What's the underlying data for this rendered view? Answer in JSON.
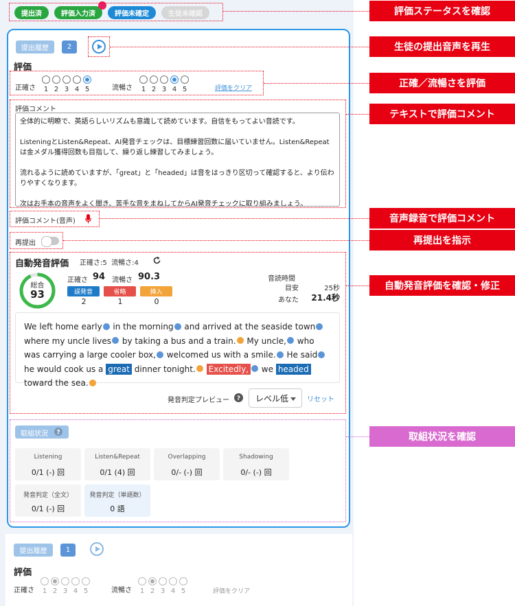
{
  "status_pills": [
    "提出済",
    "評価入力済",
    "評価未確定",
    "生徒未確認"
  ],
  "callouts": {
    "status": "評価ステータスを確認",
    "play": "生徒の提出音声を再生",
    "rate": "正確／流暢さを評価",
    "text_comment": "テキストで評価コメント",
    "voice_comment": "音声録音で評価コメント",
    "resubmit": "再提出を指示",
    "auto": "自動発音評価を確認・修正",
    "progress": "取組状況を確認"
  },
  "submission": {
    "history_label": "提出履歴",
    "count": "2",
    "eval_heading": "評価",
    "accuracy_label": "正確さ",
    "fluency_label": "流暢さ",
    "scale": [
      "1",
      "2",
      "3",
      "4",
      "5"
    ],
    "accuracy_value": 5,
    "fluency_value": 4,
    "clear_label": "評価をクリア",
    "comment_label": "評価コメント",
    "comment_paragraphs": [
      "全体的に明瞭で、英語らしいリズムも意識して読めています。自信をもってよい音読です。",
      "ListeningとListen&Repeat、AI発音チェックは、目標練習回数に届いていません。Listen&Repeatは金メダル獲得回数も目指して、繰り返し練習してみましょう。",
      "流れるように読めていますが、「great」と「headed」は音をはっきり区切って確認すると、より伝わりやすくなります。",
      "次はお手本の音声をよく聞き、苦手な音をまねしてからAI発音チェックに取り組みましょう。"
    ],
    "voice_comment_label": "評価コメント(音声)",
    "resubmit_label": "再提出"
  },
  "auto_eval": {
    "title": "自動発音評価",
    "summary": "正確さ:5  流暢さ:4",
    "total_label": "総合",
    "total": "93",
    "total_ratio": 0.93,
    "accuracy_label": "正確さ",
    "accuracy": "94",
    "fluency_label": "流暢さ",
    "fluency": "90.3",
    "tags": [
      {
        "label": "誤発音",
        "count": "2",
        "color": "#1e7bc8"
      },
      {
        "label": "省略",
        "count": "1",
        "color": "#e5504a"
      },
      {
        "label": "挿入",
        "count": "0",
        "color": "#f2a33a"
      }
    ],
    "reading_time_label": "音読時間",
    "target_label": "目安",
    "target_value": "25秒",
    "you_label": "あなた",
    "you_value": "21.4秒",
    "preview_label": "発音判定プレビュー",
    "level_value": "レベル低",
    "reset_label": "リセット"
  },
  "progress": {
    "title": "取組状況",
    "cards": [
      {
        "title": "Listening",
        "value": "0/1 (-) 回"
      },
      {
        "title": "Listen&Repeat",
        "value": "0/1 (4) 回"
      },
      {
        "title": "Overlapping",
        "value": "0/- (-) 回"
      },
      {
        "title": "Shadowing",
        "value": "0/- (-) 回"
      },
      {
        "title": "発音判定（全文）",
        "value": "0/1 (-) 回"
      },
      {
        "title": "発音判定（単語数）",
        "value": "0 語"
      }
    ]
  },
  "submission2": {
    "history_label": "提出履歴",
    "count": "1",
    "eval_heading": "評価",
    "accuracy_label": "正確さ",
    "fluency_label": "流暢さ",
    "scale": [
      "1",
      "2",
      "3",
      "4",
      "5"
    ],
    "accuracy_value": 2,
    "fluency_value": 2,
    "clear_label": "評価をクリア"
  },
  "colors": {
    "accent": "#2b96e8",
    "callout": "#e60012",
    "callout_pink": "#d96bd0",
    "score_ring": "#3cb84a"
  }
}
